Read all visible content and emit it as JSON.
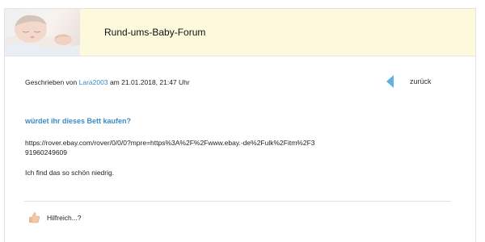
{
  "header": {
    "site_title": "Rund-ums-Baby-Forum",
    "photo_icon": "sleeping-baby-photo"
  },
  "post": {
    "meta_prefix": "Geschrieben von",
    "author": "Lara2003",
    "meta_at": "am",
    "datetime": "21.01.2018, 21:47 Uhr",
    "title": "würdet ihr dieses Bett kaufen?",
    "url_text": "https://rover.ebay.com/rover/0/0/0?mpre=https%3A%2F%2Fwww.ebay.-de%2Fulk%2Fitm%2F391960249609",
    "body_text": "Ich find das so schön niedrig."
  },
  "nav": {
    "back_label": "zurück",
    "back_icon": "left-triangle-icon"
  },
  "footer": {
    "helpful_label": "Hilfreich...?",
    "helpful_icon": "thumbs-up-icon"
  },
  "colors": {
    "accent": "#3a8cc7",
    "banner": "#fdf9dc",
    "arrow": "#5fb2e6"
  }
}
